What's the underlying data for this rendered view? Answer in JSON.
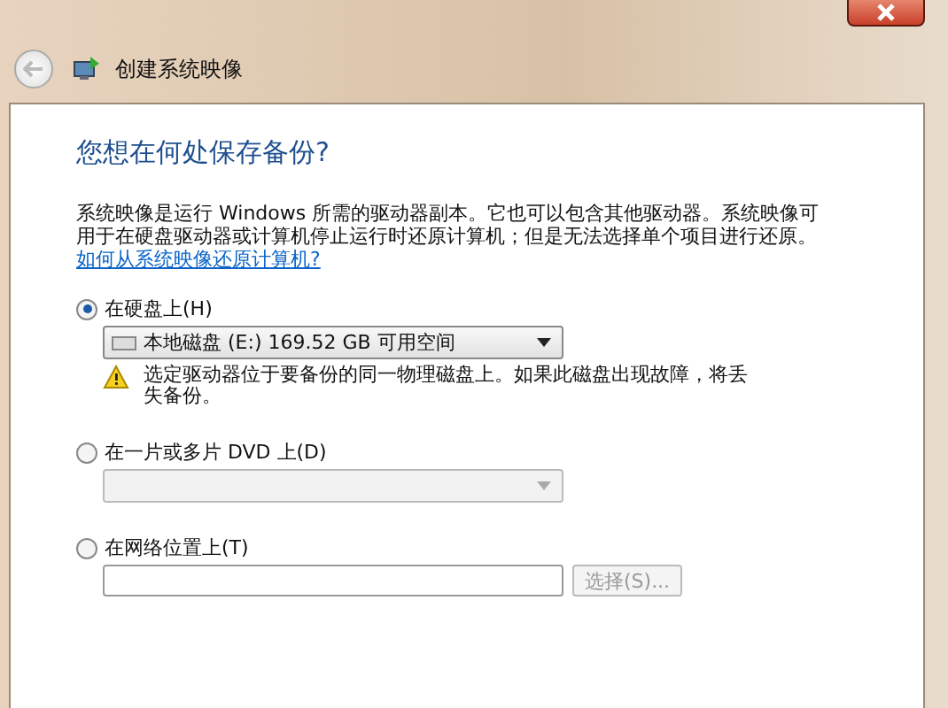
{
  "window": {
    "title": "创建系统映像"
  },
  "heading": "您想在何处保存备份?",
  "description": "系统映像是运行 Windows 所需的驱动器副本。它也可以包含其他驱动器。系统映像可用于在硬盘驱动器或计算机停止运行时还原计算机；但是无法选择单个项目进行还原。",
  "help_link": "如何从系统映像还原计算机?",
  "options": [
    {
      "label": "在硬盘上(H)",
      "selected": true,
      "kind": "dropdown",
      "disabled": false,
      "value": "本地磁盘 (E:) 169.52 GB 可用空间",
      "warning": "选定驱动器位于要备份的同一物理磁盘上。如果此磁盘出现故障，将丢失备份。"
    },
    {
      "label": "在一片或多片 DVD 上(D)",
      "selected": false,
      "kind": "dropdown",
      "disabled": true
    },
    {
      "label": "在网络位置上(T)",
      "selected": false,
      "kind": "path",
      "button": "选择(S)..."
    }
  ]
}
